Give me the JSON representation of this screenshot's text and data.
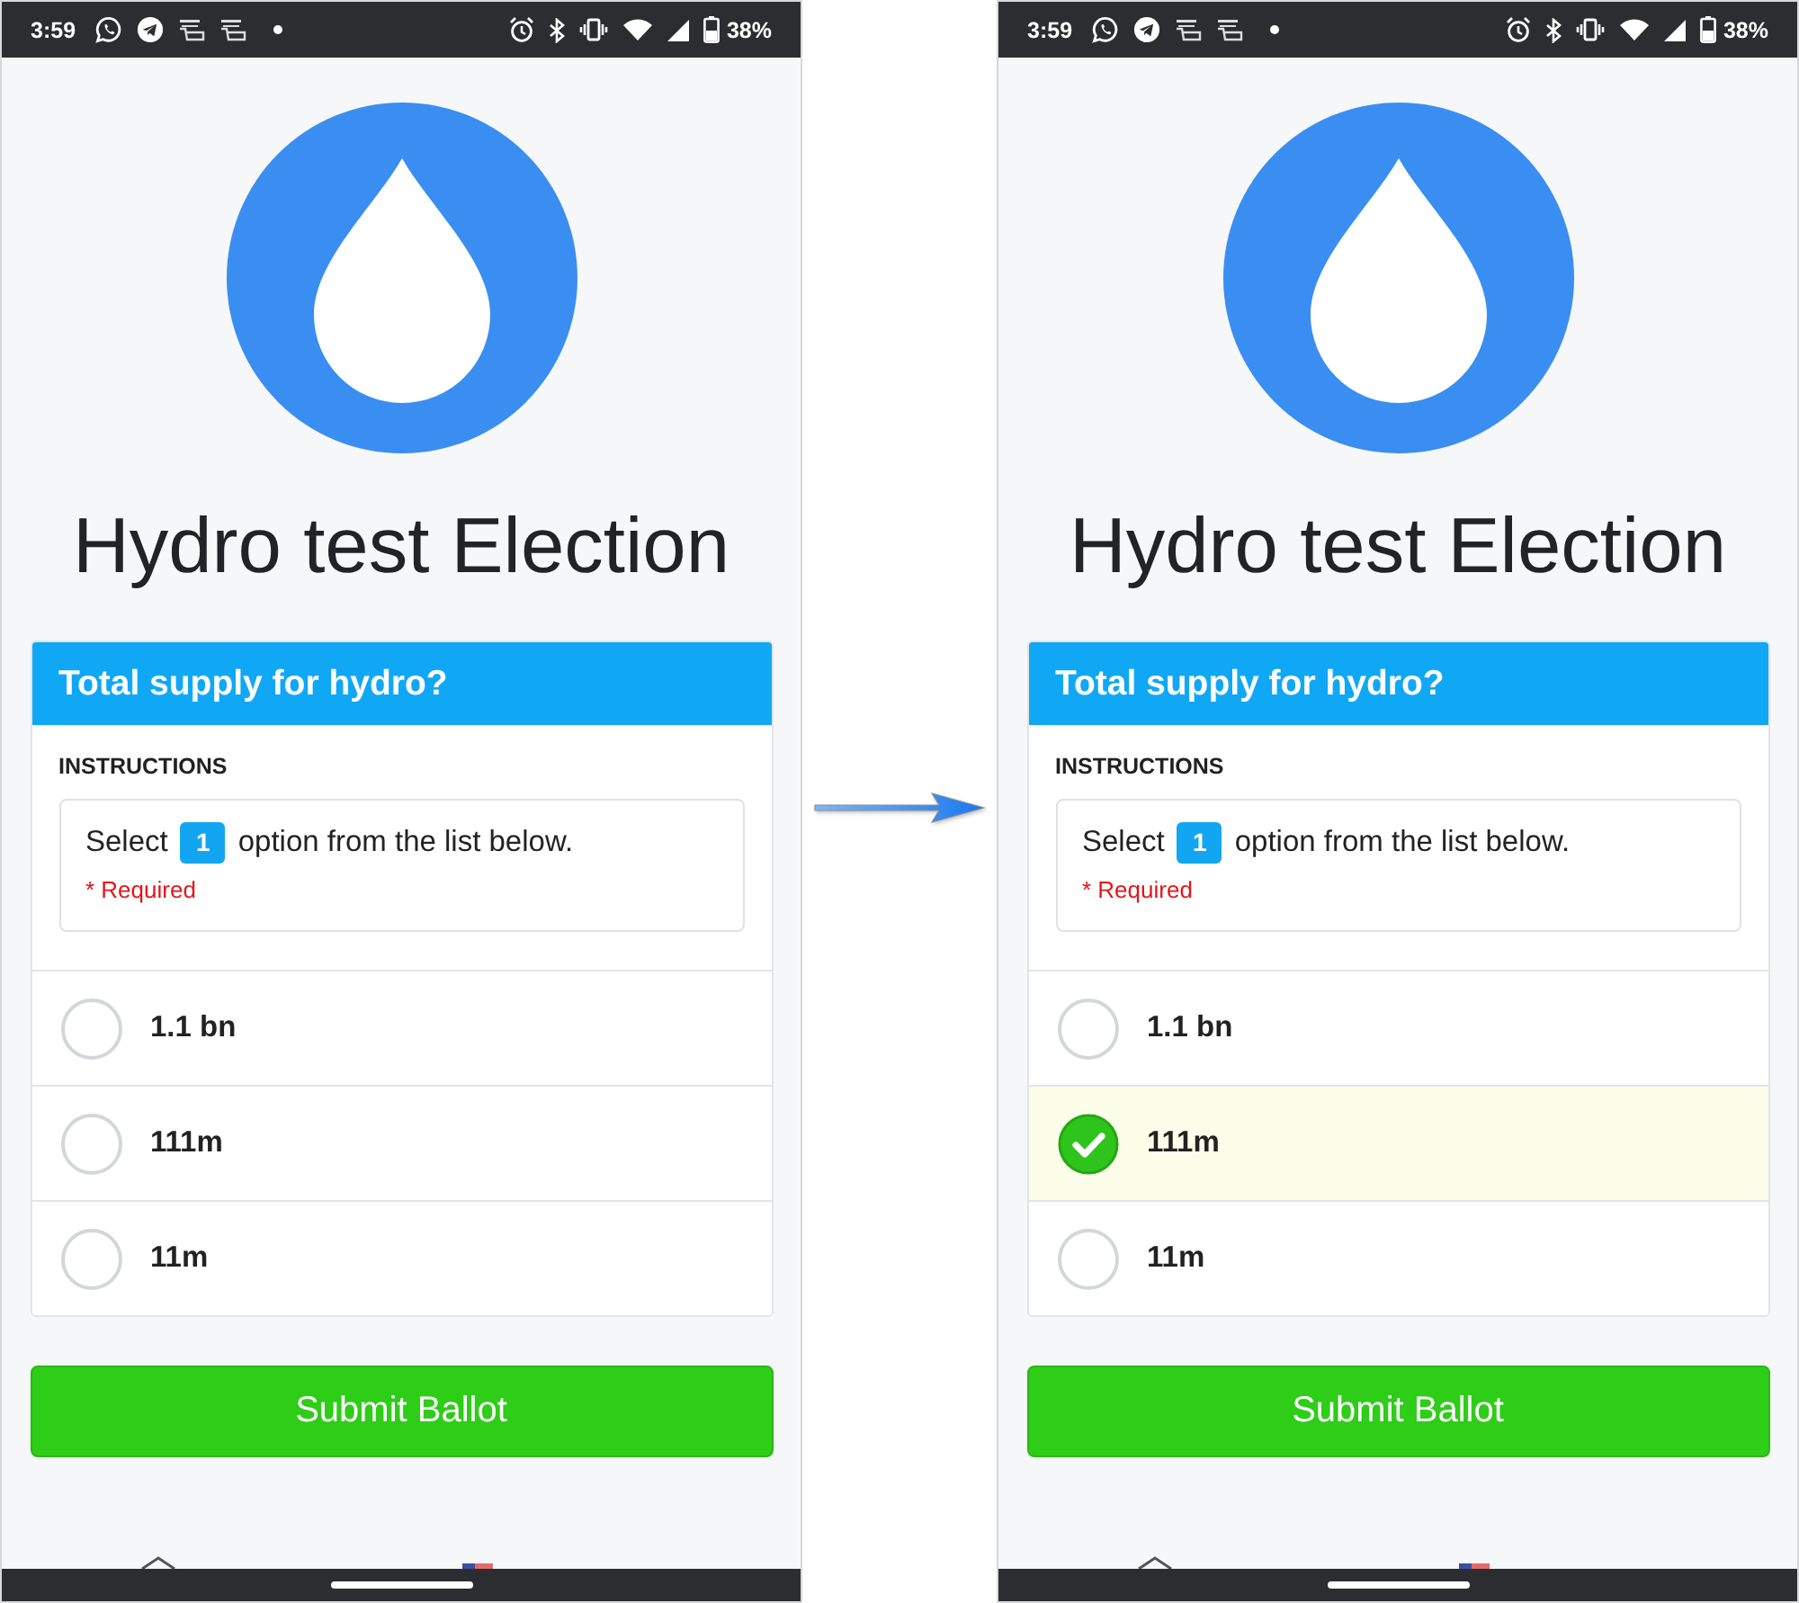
{
  "screens": [
    {
      "status_bar": {
        "time": "3:59",
        "battery_text": "38%"
      },
      "title": "Hydro test Election",
      "question": {
        "heading": "Total supply for hydro?",
        "instructions_label": "INSTRUCTIONS",
        "instruction_before": "Select",
        "select_count": "1",
        "instruction_after": "option from the list below.",
        "required_note": "* Required",
        "options": [
          {
            "label": "1.1 bn",
            "selected": false
          },
          {
            "label": "111m",
            "selected": false
          },
          {
            "label": "11m",
            "selected": false
          }
        ]
      },
      "submit_button": "Submit Ballot"
    },
    {
      "status_bar": {
        "time": "3:59",
        "battery_text": "38%"
      },
      "title": "Hydro test Election",
      "question": {
        "heading": "Total supply for hydro?",
        "instructions_label": "INSTRUCTIONS",
        "instruction_before": "Select",
        "select_count": "1",
        "instruction_after": "option from the list below.",
        "required_note": "* Required",
        "options": [
          {
            "label": "1.1 bn",
            "selected": false
          },
          {
            "label": "111m",
            "selected": true
          },
          {
            "label": "11m",
            "selected": false
          }
        ]
      },
      "submit_button": "Submit Ballot"
    }
  ]
}
